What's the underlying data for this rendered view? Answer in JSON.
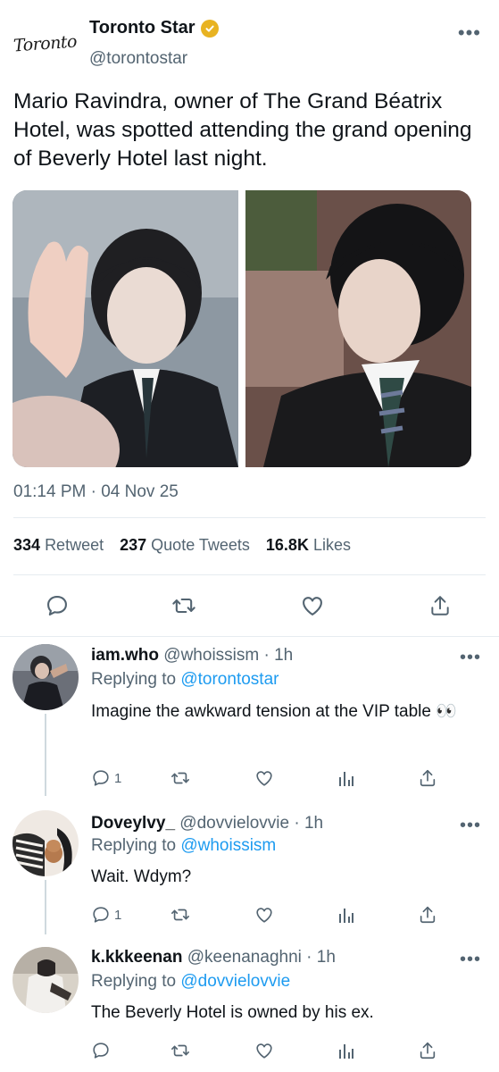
{
  "tweet": {
    "avatar_text": "Toronto",
    "author_name": "Toronto Star",
    "author_handle": "@torontostar",
    "text": "Mario Ravindra, owner of The Grand Béatrix Hotel, was spotted attending the grand opening of Beverly Hotel last night.",
    "timestamp": "01:14 PM · 04 Nov 25",
    "stats": {
      "retweets": "334",
      "retweets_label": "Retweet",
      "quote_tweets": "237",
      "quote_tweets_label": "Quote Tweets",
      "likes": "16.8K",
      "likes_label": "Likes"
    },
    "more_label": "•••"
  },
  "replies": [
    {
      "name": "iam.who",
      "handle": "@whoissism",
      "time": "· 1h",
      "replying_prefix": "Replying to",
      "replying_to": "@torontostar",
      "text": "Imagine the awkward tension at the VIP table 👀",
      "reply_count": "1",
      "more_label": "•••"
    },
    {
      "name": "Doveylvy_",
      "handle": "@dovvielovvie",
      "time": "· 1h",
      "replying_prefix": "Replying to",
      "replying_to": "@whoissism",
      "text": "Wait. Wdym?",
      "reply_count": "1",
      "more_label": "•••"
    },
    {
      "name": "k.kkkeenan",
      "handle": "@keenanaghni",
      "time": "· 1h",
      "replying_prefix": "Replying to",
      "replying_to": "@dovvielovvie",
      "text": "The Beverly Hotel is owned by his ex.",
      "reply_count": "",
      "more_label": "•••"
    }
  ],
  "icons": {
    "reply": "reply-icon",
    "retweet": "retweet-icon",
    "like": "heart-icon",
    "share": "share-icon",
    "analytics": "analytics-icon",
    "verified": "verified-badge-icon",
    "more": "more-icon"
  },
  "colors": {
    "link": "#1d9bf0",
    "secondary_text": "#536471",
    "verified_badge": "#e8b322",
    "divider": "#e6ecf0"
  }
}
